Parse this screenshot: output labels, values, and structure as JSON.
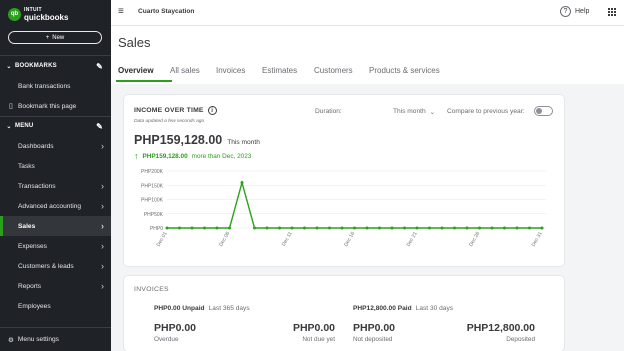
{
  "brand": {
    "intuit": "INTUIT",
    "name": "quickbooks",
    "mark": "qb",
    "color": "#2ca01c"
  },
  "sidebar": {
    "new_label": "New",
    "bookmarks_section": "BOOKMARKS",
    "bookmarks": [
      {
        "label": "Bank transactions"
      },
      {
        "label": "Bookmark this page",
        "icon": "bookmark-icon"
      }
    ],
    "menu_section": "MENU",
    "menu": [
      {
        "label": "Dashboards",
        "active": false
      },
      {
        "label": "Tasks",
        "active": false
      },
      {
        "label": "Transactions",
        "active": false
      },
      {
        "label": "Advanced accounting",
        "active": false
      },
      {
        "label": "Sales",
        "active": true
      },
      {
        "label": "Expenses",
        "active": false
      },
      {
        "label": "Customers & leads",
        "active": false
      },
      {
        "label": "Reports",
        "active": false
      },
      {
        "label": "Employees",
        "active": false
      }
    ],
    "settings_label": "Menu settings"
  },
  "topbar": {
    "company": "Cuarto Staycation",
    "help_label": "Help"
  },
  "page": {
    "title": "Sales",
    "tabs": [
      "Overview",
      "All sales",
      "Invoices",
      "Estimates",
      "Customers",
      "Products & services"
    ],
    "active_tab": 0
  },
  "income": {
    "title": "INCOME OVER TIME",
    "updated": "Data updated a few seconds ago",
    "duration_label": "Duration:",
    "duration_value": "This month",
    "compare_label": "Compare to previous year:",
    "compare_on": false,
    "amount": "PHP159,128.00",
    "period": "This month",
    "delta_amount": "PHP159,128.00",
    "delta_text": "more than Dec, 2023"
  },
  "chart_data": {
    "type": "line",
    "x": [
      "Dec 01",
      "Dec 02",
      "Dec 03",
      "Dec 04",
      "Dec 05",
      "Dec 06",
      "Dec 07",
      "Dec 08",
      "Dec 09",
      "Dec 10",
      "Dec 11",
      "Dec 12",
      "Dec 13",
      "Dec 14",
      "Dec 15",
      "Dec 16",
      "Dec 17",
      "Dec 18",
      "Dec 19",
      "Dec 20",
      "Dec 21",
      "Dec 22",
      "Dec 23",
      "Dec 24",
      "Dec 25",
      "Dec 26",
      "Dec 27",
      "Dec 28",
      "Dec 29",
      "Dec 30",
      "Dec 31"
    ],
    "values": [
      0,
      0,
      0,
      0,
      0,
      0,
      159128,
      0,
      0,
      0,
      0,
      0,
      0,
      0,
      0,
      0,
      0,
      0,
      0,
      0,
      0,
      0,
      0,
      0,
      0,
      0,
      0,
      0,
      0,
      0,
      0
    ],
    "yticks": [
      "PHP200K",
      "PHP150K",
      "PHP100K",
      "PHP50K",
      "PHP0"
    ],
    "ylim": [
      0,
      200000
    ],
    "xticks_shown": [
      "Dec 01",
      "Dec 06",
      "Dec 11",
      "Dec 16",
      "Dec 21",
      "Dec 26",
      "Dec 31"
    ],
    "line_color": "#2ca01c"
  },
  "invoices": {
    "title": "INVOICES",
    "unpaid_amount": "PHP0.00 Unpaid",
    "unpaid_period": "Last 365 days",
    "paid_amount": "PHP12,800.00 Paid",
    "paid_period": "Last 30 days",
    "stats": [
      {
        "value": "PHP0.00",
        "label": "Overdue"
      },
      {
        "value": "PHP0.00",
        "label": "Not due yet"
      },
      {
        "value": "PHP0.00",
        "label": "Not deposited"
      },
      {
        "value": "PHP12,800.00",
        "label": "Deposited"
      }
    ]
  }
}
